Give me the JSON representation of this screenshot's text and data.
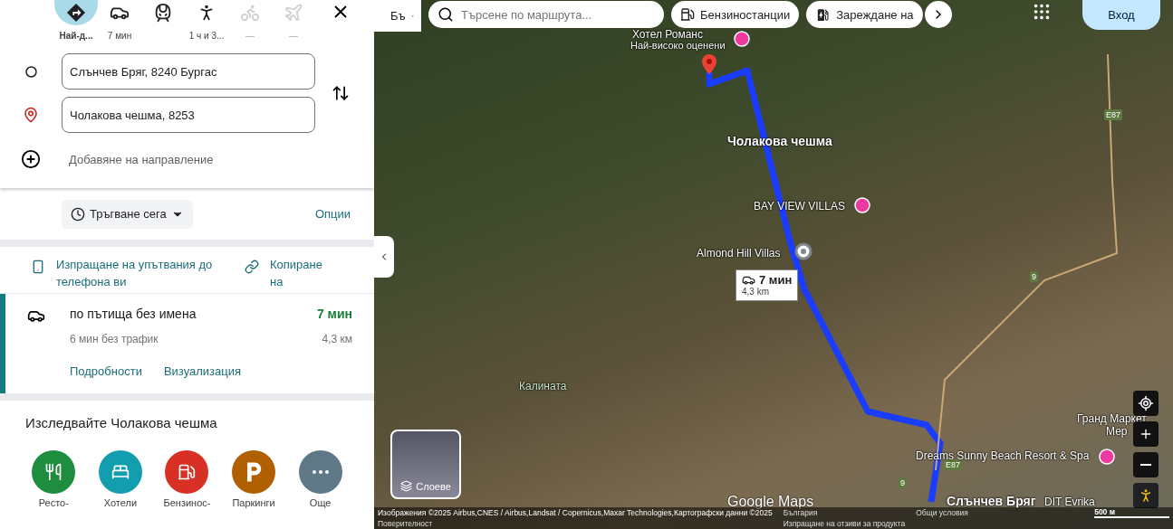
{
  "modes": [
    {
      "kind": "best",
      "label": "Най-д...",
      "selected": true,
      "disabled": false
    },
    {
      "kind": "car",
      "label": "7 мин",
      "selected": false,
      "disabled": false
    },
    {
      "kind": "transit",
      "selected": false,
      "disabled": false
    },
    {
      "kind": "walk",
      "label": "1 ч и 3...",
      "selected": false,
      "disabled": false
    },
    {
      "kind": "bike",
      "label": "—",
      "selected": false,
      "disabled": true
    },
    {
      "kind": "flight",
      "label": "—",
      "selected": false,
      "disabled": true
    }
  ],
  "origin": "Слънчев Бряг, 8240 Бургас",
  "destination": "Чолакова чешма, 8253",
  "add_destination": "Добавяне на направление",
  "depart": "Тръгване сега",
  "options": "Опции",
  "share": {
    "send": "Изпращане на упътвания до телефона ви",
    "copy": "Копиране на"
  },
  "route": {
    "title": "по пътища без имена",
    "time": "7 мин",
    "subtitle": "6 мин без трафик",
    "distance": "4,3 км",
    "selected": true,
    "links": [
      "Подробности",
      "Визуализация"
    ]
  },
  "explore": {
    "title": "Изследвайте Чолакова чешма",
    "categories": [
      {
        "kind": "restaurant",
        "label": "Ресто-",
        "color": "#1e8e3e"
      },
      {
        "kind": "hotel",
        "label": "Хотели",
        "color": "#129eaf"
      },
      {
        "kind": "fuel",
        "label": "Бензинос-",
        "color": "#d93025"
      },
      {
        "kind": "parking",
        "label": "Паркинги",
        "color": "#b06000"
      },
      {
        "kind": "more",
        "label": "Още",
        "color": "#5f7888"
      }
    ]
  },
  "map": {
    "language": "Бъ",
    "search_placeholder": "Търсене по маршрута...",
    "chips": [
      {
        "kind": "fuel",
        "label": "Бензиностанции"
      },
      {
        "kind": "charging",
        "label": "Зареждане на"
      }
    ],
    "sign_in": "Вход",
    "labels": [
      {
        "kind": "poi",
        "text": "Хотел Романс"
      },
      {
        "kind": "small",
        "text": "Най-високо оценени"
      },
      {
        "kind": "town",
        "text": "Чолакова чешма"
      },
      {
        "kind": "poi",
        "text": "BAY VIEW VILLAS"
      },
      {
        "kind": "poi",
        "text": "Almond Hill Villas"
      },
      {
        "kind": "area",
        "text": "Калината"
      },
      {
        "kind": "road",
        "text": "E87"
      },
      {
        "kind": "road",
        "text": "9"
      },
      {
        "kind": "road",
        "text": "E87"
      },
      {
        "kind": "road",
        "text": "9"
      },
      {
        "kind": "poi",
        "text": "Гранд Маркет"
      },
      {
        "kind": "poi",
        "text": "Мер"
      },
      {
        "kind": "poi",
        "text": "Dreams Sunny Beach Resort & Spa"
      },
      {
        "kind": "town",
        "text": "Слънчев Бряг"
      },
      {
        "kind": "poi",
        "text": "DIT Evrika"
      }
    ],
    "route_badge": {
      "time": "7 мин",
      "distance": "4,3 km"
    },
    "layers": "Слоеве",
    "brand": "Google Maps",
    "attribution": "Изображения ©2025 Airbus,CNES / Airbus,Landsat / Copernicus,Maxar Technologies,Картографски данни ©2025",
    "footer_links": [
      "България",
      "Общи условия"
    ],
    "scale": "500 м",
    "footer_links_2": [
      "Поверителност",
      "Изпращане на отзиви за продукта"
    ]
  }
}
